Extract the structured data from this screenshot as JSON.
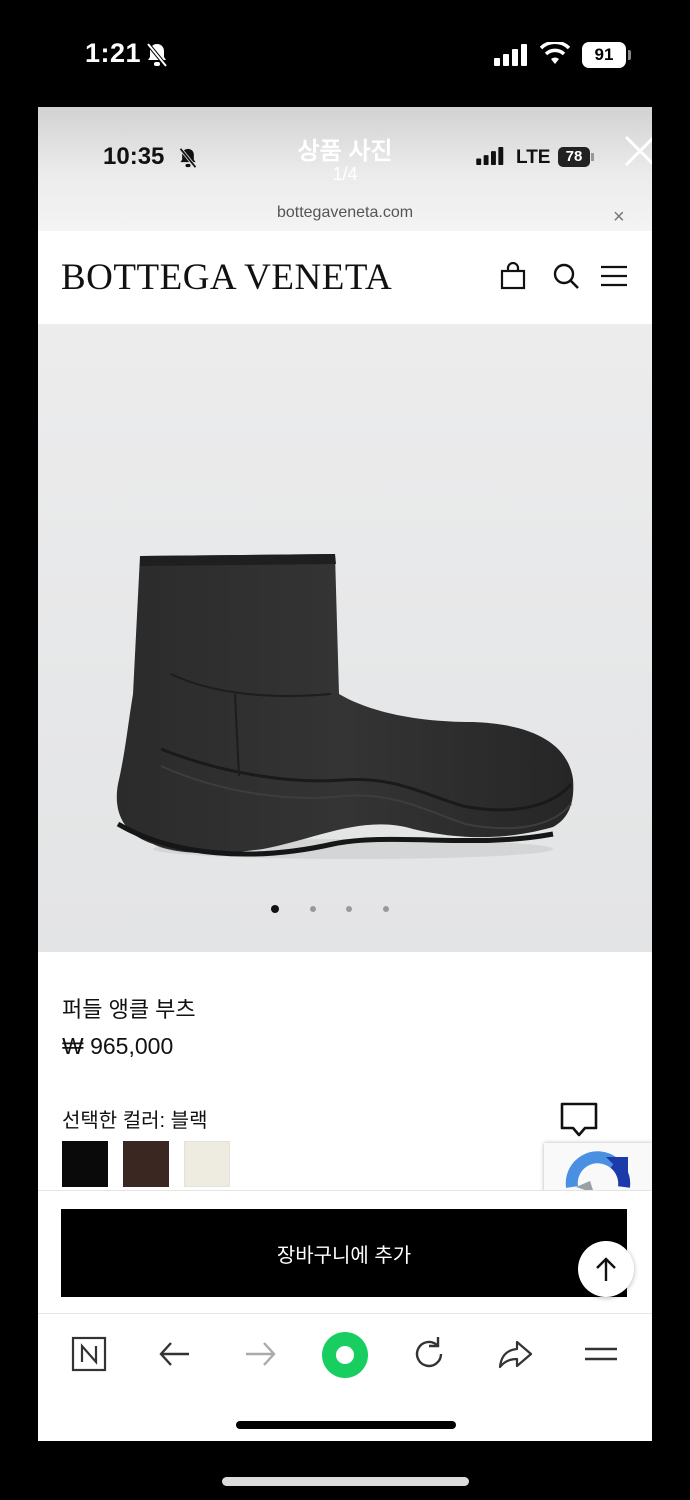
{
  "outer_status": {
    "time": "1:21",
    "battery": "91"
  },
  "viewer": {
    "time": "10:35",
    "title": "상품 사진",
    "counter": "1/4",
    "network": "LTE",
    "battery": "78",
    "url": "bottegaveneta.com",
    "url_close": "×"
  },
  "site": {
    "logo": "BOTTEGA VENETA"
  },
  "product": {
    "name": "퍼들 앵클 부츠",
    "price": "₩ 965,000",
    "color_label": "선택한 컬러: 블랙",
    "colors": [
      {
        "name": "black",
        "hex": "#0a0a0a"
      },
      {
        "name": "brown",
        "hex": "#3a2721"
      },
      {
        "name": "cream",
        "hex": "#eeebe1"
      }
    ],
    "image_count": 4,
    "current_image": 1
  },
  "cta": {
    "add_to_cart": "장바구니에 추가"
  },
  "toolbar": {
    "items": [
      "naver-home",
      "back",
      "forward",
      "green-dot",
      "refresh",
      "share",
      "menu"
    ],
    "accent_color": "#19ce60"
  }
}
